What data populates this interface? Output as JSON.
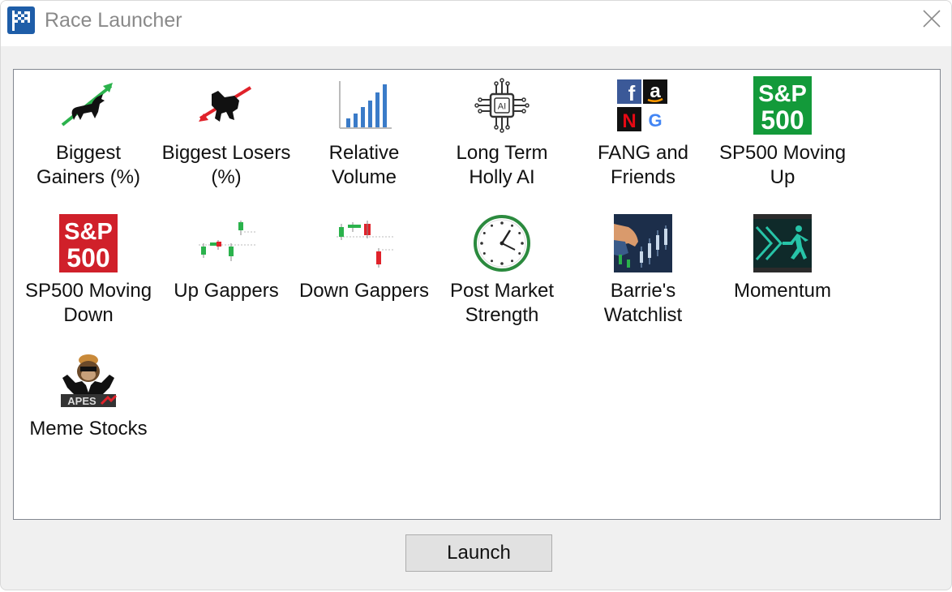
{
  "window": {
    "title": "Race Launcher",
    "app_icon": "checkered-flag-icon",
    "close_icon": "close-icon"
  },
  "races": [
    {
      "id": "biggest-gainers",
      "label": "Biggest\nGainers (%)",
      "icon": "bull-up-arrow-icon"
    },
    {
      "id": "biggest-losers",
      "label": "Biggest Losers\n(%)",
      "icon": "bear-down-arrow-icon"
    },
    {
      "id": "relative-volume",
      "label": "Relative\nVolume",
      "icon": "volume-bars-icon"
    },
    {
      "id": "long-term-holly-ai",
      "label": "Long Term\nHolly AI",
      "icon": "ai-chip-icon"
    },
    {
      "id": "fang-and-friends",
      "label": "FANG and\nFriends",
      "icon": "fang-logos-icon"
    },
    {
      "id": "sp500-moving-up",
      "label": "SP500 Moving\nUp",
      "icon": "sp500-green-icon"
    },
    {
      "id": "sp500-moving-down",
      "label": "SP500 Moving\nDown",
      "icon": "sp500-red-icon"
    },
    {
      "id": "up-gappers",
      "label": "Up Gappers",
      "icon": "up-gap-candles-icon"
    },
    {
      "id": "down-gappers",
      "label": "Down Gappers",
      "icon": "down-gap-candles-icon"
    },
    {
      "id": "post-market-strength",
      "label": "Post Market\nStrength",
      "icon": "clock-icon"
    },
    {
      "id": "barries-watchlist",
      "label": "Barrie's\nWatchlist",
      "icon": "watchlist-hand-icon"
    },
    {
      "id": "momentum",
      "label": "Momentum",
      "icon": "runner-icon"
    },
    {
      "id": "meme-stocks",
      "label": "Meme Stocks",
      "icon": "apes-icon"
    }
  ],
  "icon_text": {
    "sp500_line1": "S&P",
    "sp500_line2": "500",
    "ai": "AI",
    "apes": "APES"
  },
  "colors": {
    "sp500_green": "#139a3a",
    "sp500_red": "#d0202a",
    "chart_blue": "#3a7bc8",
    "arrow_green": "#2bb24c",
    "arrow_red": "#e0222a"
  },
  "footer": {
    "launch_label": "Launch"
  }
}
